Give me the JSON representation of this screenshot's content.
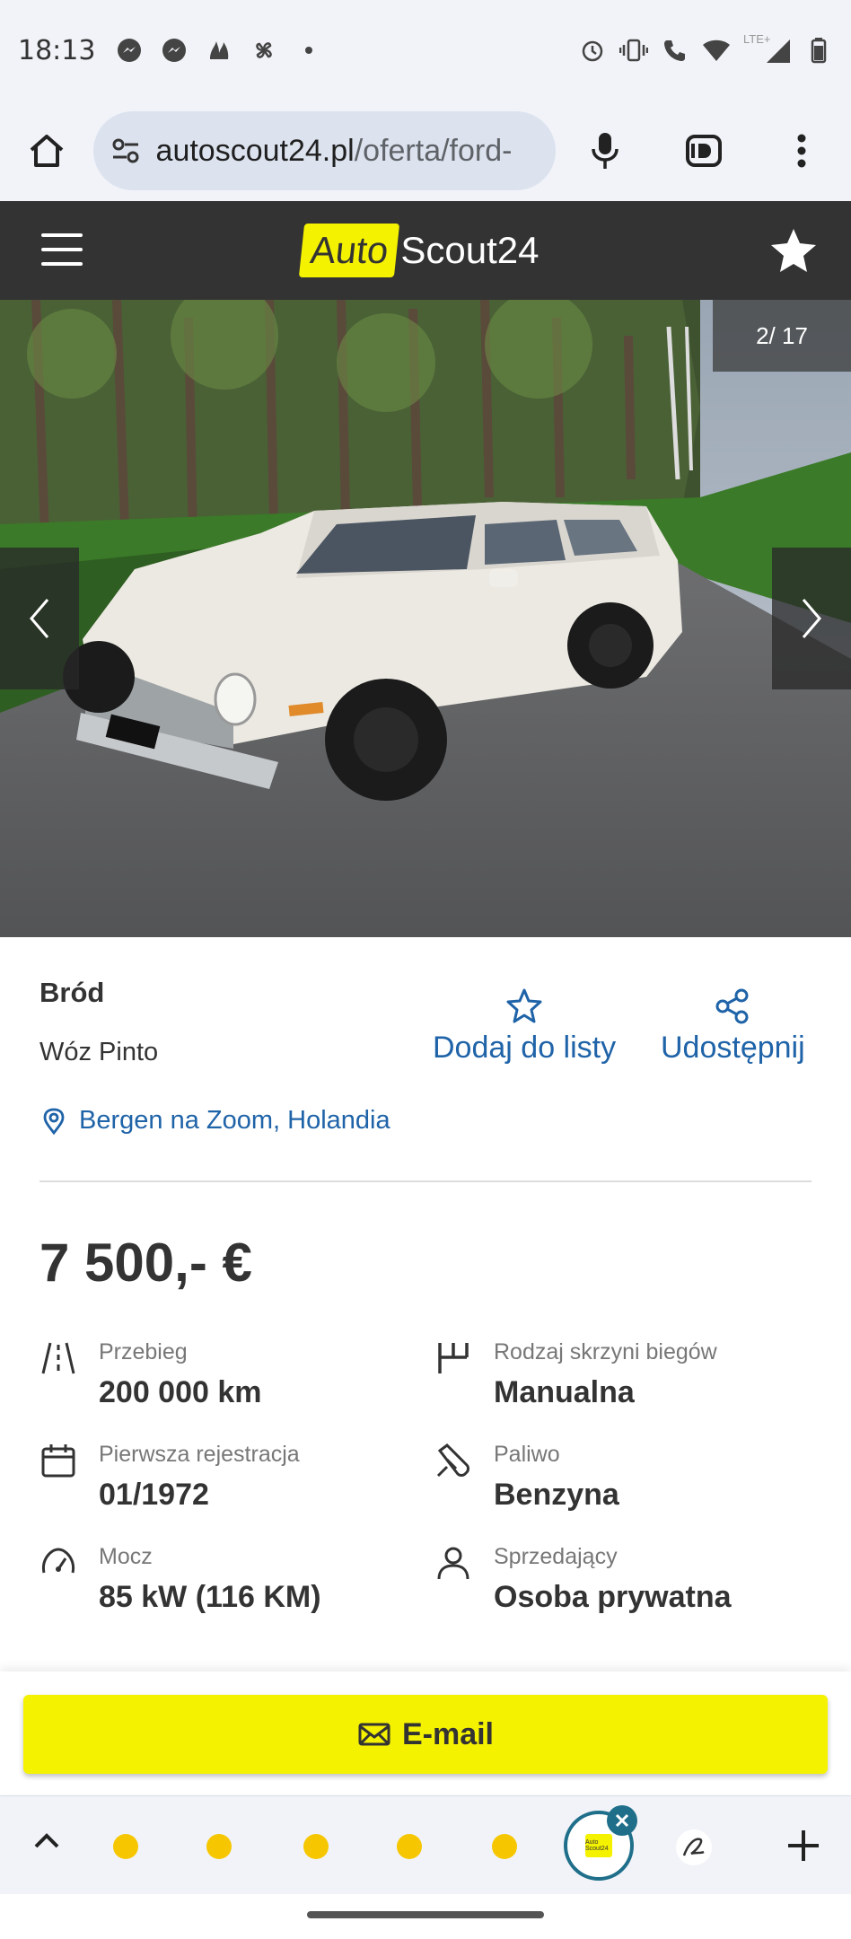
{
  "status_bar": {
    "time": "18:13",
    "network": "LTE+"
  },
  "browser": {
    "url_domain": "autoscout24.pl",
    "url_path": "/oferta/ford-"
  },
  "header": {
    "logo_auto": "Auto",
    "logo_scout": "Scout24"
  },
  "gallery": {
    "counter": "2/ 17"
  },
  "listing": {
    "title": "Bród",
    "subtitle": "Wóz Pinto",
    "add_to_list": "Dodaj do listy",
    "share": "Udostępnij",
    "location": "Bergen na Zoom, Holandia",
    "price": "7 500,- €"
  },
  "specs": [
    {
      "label": "Przebieg",
      "value": "200 000 km",
      "icon": "road-icon"
    },
    {
      "label": "Rodzaj skrzyni biegów",
      "value": "Manualna",
      "icon": "gearbox-icon"
    },
    {
      "label": "Pierwsza rejestracja",
      "value": "01/1972",
      "icon": "calendar-icon"
    },
    {
      "label": "Paliwo",
      "value": "Benzyna",
      "icon": "fuel-icon"
    },
    {
      "label": "Mocz",
      "value": "85 kW (116 KM)",
      "icon": "speedometer-icon"
    },
    {
      "label": "Sprzedający",
      "value": "Osoba prywatna",
      "icon": "person-icon"
    }
  ],
  "contact": {
    "email_label": "E-mail"
  },
  "tabs": {
    "active_tab_logo": "Auto Scout24"
  },
  "colors": {
    "brand_yellow": "#f5f200",
    "link_blue": "#1f63a8",
    "header_dark": "#333333"
  }
}
